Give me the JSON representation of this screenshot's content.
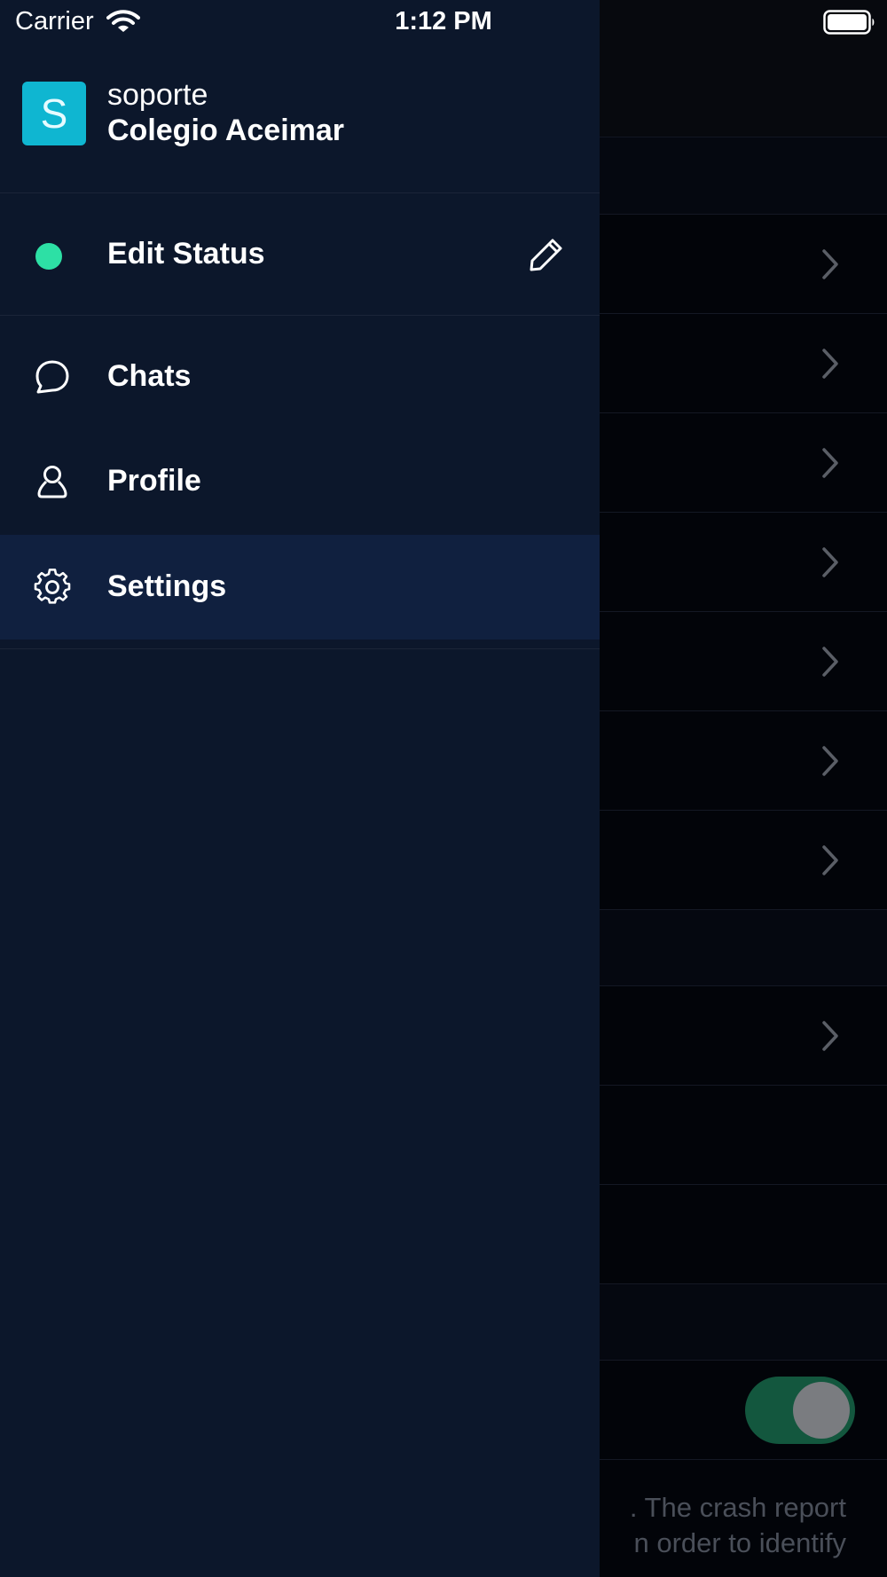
{
  "status_bar": {
    "carrier": "Carrier",
    "time": "1:12 PM"
  },
  "drawer": {
    "avatar_letter": "S",
    "user_name": "soporte",
    "workspace_name": "Colegio Aceimar",
    "status": {
      "label": "Edit Status",
      "dot_color": "#2de0a5"
    },
    "menu": [
      {
        "label": "Chats",
        "icon": "chat-bubble-icon",
        "active": false
      },
      {
        "label": "Profile",
        "icon": "user-icon",
        "active": false
      },
      {
        "label": "Settings",
        "icon": "gear-icon",
        "active": true
      }
    ]
  },
  "background": {
    "footer_lines": [
      ". The crash report",
      "n order to identify"
    ],
    "toggle_on": true,
    "toggle_color": "#13573e"
  }
}
